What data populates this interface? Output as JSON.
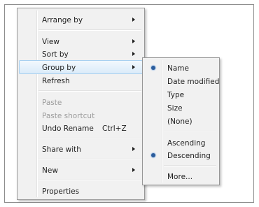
{
  "context_menu": {
    "items": [
      {
        "label": "Arrange by",
        "submenu": true
      },
      {
        "label": "View",
        "submenu": true
      },
      {
        "label": "Sort by",
        "submenu": true
      },
      {
        "label": "Group by",
        "submenu": true,
        "highlighted": true
      },
      {
        "label": "Refresh"
      },
      {
        "label": "Paste",
        "disabled": true
      },
      {
        "label": "Paste shortcut",
        "disabled": true
      },
      {
        "label": "Undo Rename",
        "shortcut": "Ctrl+Z"
      },
      {
        "label": "Share with",
        "submenu": true
      },
      {
        "label": "New",
        "submenu": true
      },
      {
        "label": "Properties"
      }
    ]
  },
  "group_by_submenu": {
    "items": [
      {
        "label": "Name",
        "selected": true
      },
      {
        "label": "Date modified"
      },
      {
        "label": "Type"
      },
      {
        "label": "Size"
      },
      {
        "label": "(None)"
      },
      {
        "label": "Ascending"
      },
      {
        "label": "Descending",
        "selected": true
      },
      {
        "label": "More..."
      }
    ]
  },
  "colors": {
    "menu_background": "#f1f1f1",
    "highlight_border": "#a8d0f0",
    "bullet": "#2c5d9c",
    "disabled_text": "#9c9c9c"
  }
}
